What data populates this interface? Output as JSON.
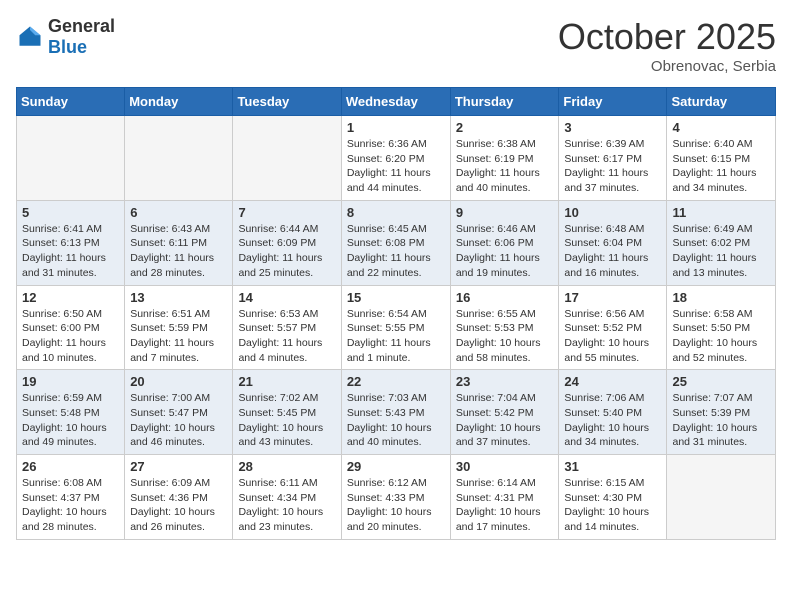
{
  "header": {
    "logo_general": "General",
    "logo_blue": "Blue",
    "month_title": "October 2025",
    "subtitle": "Obrenovac, Serbia"
  },
  "weekdays": [
    "Sunday",
    "Monday",
    "Tuesday",
    "Wednesday",
    "Thursday",
    "Friday",
    "Saturday"
  ],
  "weeks": [
    [
      {
        "day": "",
        "info": ""
      },
      {
        "day": "",
        "info": ""
      },
      {
        "day": "",
        "info": ""
      },
      {
        "day": "1",
        "info": "Sunrise: 6:36 AM\nSunset: 6:20 PM\nDaylight: 11 hours and 44 minutes."
      },
      {
        "day": "2",
        "info": "Sunrise: 6:38 AM\nSunset: 6:19 PM\nDaylight: 11 hours and 40 minutes."
      },
      {
        "day": "3",
        "info": "Sunrise: 6:39 AM\nSunset: 6:17 PM\nDaylight: 11 hours and 37 minutes."
      },
      {
        "day": "4",
        "info": "Sunrise: 6:40 AM\nSunset: 6:15 PM\nDaylight: 11 hours and 34 minutes."
      }
    ],
    [
      {
        "day": "5",
        "info": "Sunrise: 6:41 AM\nSunset: 6:13 PM\nDaylight: 11 hours and 31 minutes."
      },
      {
        "day": "6",
        "info": "Sunrise: 6:43 AM\nSunset: 6:11 PM\nDaylight: 11 hours and 28 minutes."
      },
      {
        "day": "7",
        "info": "Sunrise: 6:44 AM\nSunset: 6:09 PM\nDaylight: 11 hours and 25 minutes."
      },
      {
        "day": "8",
        "info": "Sunrise: 6:45 AM\nSunset: 6:08 PM\nDaylight: 11 hours and 22 minutes."
      },
      {
        "day": "9",
        "info": "Sunrise: 6:46 AM\nSunset: 6:06 PM\nDaylight: 11 hours and 19 minutes."
      },
      {
        "day": "10",
        "info": "Sunrise: 6:48 AM\nSunset: 6:04 PM\nDaylight: 11 hours and 16 minutes."
      },
      {
        "day": "11",
        "info": "Sunrise: 6:49 AM\nSunset: 6:02 PM\nDaylight: 11 hours and 13 minutes."
      }
    ],
    [
      {
        "day": "12",
        "info": "Sunrise: 6:50 AM\nSunset: 6:00 PM\nDaylight: 11 hours and 10 minutes."
      },
      {
        "day": "13",
        "info": "Sunrise: 6:51 AM\nSunset: 5:59 PM\nDaylight: 11 hours and 7 minutes."
      },
      {
        "day": "14",
        "info": "Sunrise: 6:53 AM\nSunset: 5:57 PM\nDaylight: 11 hours and 4 minutes."
      },
      {
        "day": "15",
        "info": "Sunrise: 6:54 AM\nSunset: 5:55 PM\nDaylight: 11 hours and 1 minute."
      },
      {
        "day": "16",
        "info": "Sunrise: 6:55 AM\nSunset: 5:53 PM\nDaylight: 10 hours and 58 minutes."
      },
      {
        "day": "17",
        "info": "Sunrise: 6:56 AM\nSunset: 5:52 PM\nDaylight: 10 hours and 55 minutes."
      },
      {
        "day": "18",
        "info": "Sunrise: 6:58 AM\nSunset: 5:50 PM\nDaylight: 10 hours and 52 minutes."
      }
    ],
    [
      {
        "day": "19",
        "info": "Sunrise: 6:59 AM\nSunset: 5:48 PM\nDaylight: 10 hours and 49 minutes."
      },
      {
        "day": "20",
        "info": "Sunrise: 7:00 AM\nSunset: 5:47 PM\nDaylight: 10 hours and 46 minutes."
      },
      {
        "day": "21",
        "info": "Sunrise: 7:02 AM\nSunset: 5:45 PM\nDaylight: 10 hours and 43 minutes."
      },
      {
        "day": "22",
        "info": "Sunrise: 7:03 AM\nSunset: 5:43 PM\nDaylight: 10 hours and 40 minutes."
      },
      {
        "day": "23",
        "info": "Sunrise: 7:04 AM\nSunset: 5:42 PM\nDaylight: 10 hours and 37 minutes."
      },
      {
        "day": "24",
        "info": "Sunrise: 7:06 AM\nSunset: 5:40 PM\nDaylight: 10 hours and 34 minutes."
      },
      {
        "day": "25",
        "info": "Sunrise: 7:07 AM\nSunset: 5:39 PM\nDaylight: 10 hours and 31 minutes."
      }
    ],
    [
      {
        "day": "26",
        "info": "Sunrise: 6:08 AM\nSunset: 4:37 PM\nDaylight: 10 hours and 28 minutes."
      },
      {
        "day": "27",
        "info": "Sunrise: 6:09 AM\nSunset: 4:36 PM\nDaylight: 10 hours and 26 minutes."
      },
      {
        "day": "28",
        "info": "Sunrise: 6:11 AM\nSunset: 4:34 PM\nDaylight: 10 hours and 23 minutes."
      },
      {
        "day": "29",
        "info": "Sunrise: 6:12 AM\nSunset: 4:33 PM\nDaylight: 10 hours and 20 minutes."
      },
      {
        "day": "30",
        "info": "Sunrise: 6:14 AM\nSunset: 4:31 PM\nDaylight: 10 hours and 17 minutes."
      },
      {
        "day": "31",
        "info": "Sunrise: 6:15 AM\nSunset: 4:30 PM\nDaylight: 10 hours and 14 minutes."
      },
      {
        "day": "",
        "info": ""
      }
    ]
  ]
}
